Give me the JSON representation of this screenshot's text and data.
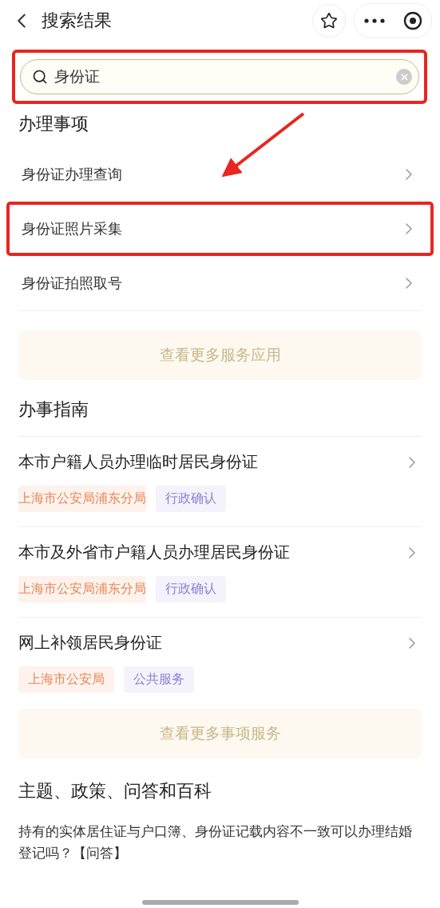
{
  "header": {
    "title": "搜索结果"
  },
  "search": {
    "value": "身份证",
    "highlighted": true
  },
  "services": {
    "heading": "办理事项",
    "items": [
      {
        "label": "身份证办理查询",
        "highlighted": false
      },
      {
        "label": "身份证照片采集",
        "highlighted": true
      },
      {
        "label": "身份证拍照取号",
        "highlighted": false
      }
    ],
    "more_button": "查看更多服务应用"
  },
  "guides": {
    "heading": "办事指南",
    "items": [
      {
        "title": "本市户籍人员办理临时居民身份证",
        "tags": [
          {
            "kind": "org",
            "label": "上海市公安局浦东分局"
          },
          {
            "kind": "type",
            "label": "行政确认"
          }
        ]
      },
      {
        "title": "本市及外省市户籍人员办理居民身份证",
        "tags": [
          {
            "kind": "org",
            "label": "上海市公安局浦东分局"
          },
          {
            "kind": "type",
            "label": "行政确认"
          }
        ]
      },
      {
        "title": "网上补领居民身份证",
        "tags": [
          {
            "kind": "org",
            "label": "上海市公安局"
          },
          {
            "kind": "type",
            "label": "公共服务"
          }
        ]
      }
    ],
    "more_button": "查看更多事项服务"
  },
  "topics": {
    "heading": "主题、政策、问答和百科",
    "items": [
      "持有的实体居住证与户口簿、身份证记载内容不一致可以办理结婚登记吗？【问答】"
    ]
  }
}
